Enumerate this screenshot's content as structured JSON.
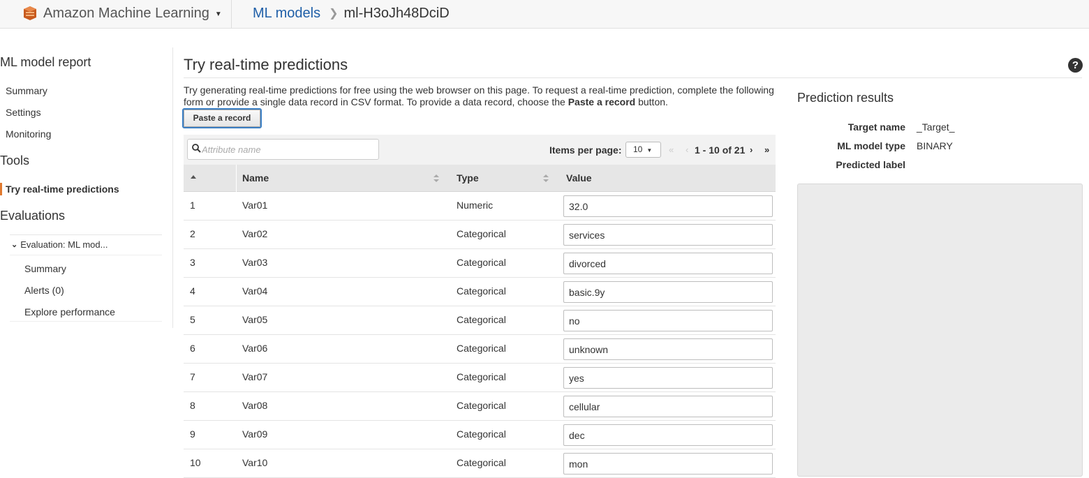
{
  "header": {
    "app_name": "Amazon Machine Learning",
    "app_icon": "aws-ml-logo-icon",
    "breadcrumb_link": "ML models",
    "breadcrumb_current": "ml-H3oJh48DciD"
  },
  "sidebar": {
    "report_heading": "ML model report",
    "report_items": [
      "Summary",
      "Settings",
      "Monitoring"
    ],
    "tools_heading": "Tools",
    "active_tool": "Try real-time predictions",
    "evaluations_heading": "Evaluations",
    "evaluation_name": "Evaluation: ML mod...",
    "evaluation_items": [
      "Summary",
      "Alerts (0)",
      "Explore performance"
    ]
  },
  "main": {
    "title": "Try real-time predictions",
    "description_part1": "Try generating real-time predictions for free using the web browser on this page. To request a real-time prediction, complete the following form or provide a single data record in CSV format. To provide a data record, choose the ",
    "description_bold": "Paste a record",
    "description_part2": " button.",
    "paste_button": "Paste a record",
    "search_placeholder": "Attribute name",
    "items_per_page_label": "Items per page:",
    "items_per_page_value": "10",
    "pagination_range": "1 - 10 of 21",
    "columns": {
      "name": "Name",
      "type": "Type",
      "value": "Value"
    },
    "rows": [
      {
        "num": "1",
        "name": "Var01",
        "type": "Numeric",
        "value": "32.0"
      },
      {
        "num": "2",
        "name": "Var02",
        "type": "Categorical",
        "value": "services"
      },
      {
        "num": "3",
        "name": "Var03",
        "type": "Categorical",
        "value": "divorced"
      },
      {
        "num": "4",
        "name": "Var04",
        "type": "Categorical",
        "value": "basic.9y"
      },
      {
        "num": "5",
        "name": "Var05",
        "type": "Categorical",
        "value": "no"
      },
      {
        "num": "6",
        "name": "Var06",
        "type": "Categorical",
        "value": "unknown"
      },
      {
        "num": "7",
        "name": "Var07",
        "type": "Categorical",
        "value": "yes"
      },
      {
        "num": "8",
        "name": "Var08",
        "type": "Categorical",
        "value": "cellular"
      },
      {
        "num": "9",
        "name": "Var09",
        "type": "Categorical",
        "value": "dec"
      },
      {
        "num": "10",
        "name": "Var10",
        "type": "Categorical",
        "value": "mon"
      }
    ]
  },
  "results": {
    "title": "Prediction results",
    "target_name_label": "Target name",
    "target_name_value": "_Target_",
    "model_type_label": "ML model type",
    "model_type_value": "BINARY",
    "predicted_label_label": "Predicted label",
    "predicted_label_value": ""
  }
}
